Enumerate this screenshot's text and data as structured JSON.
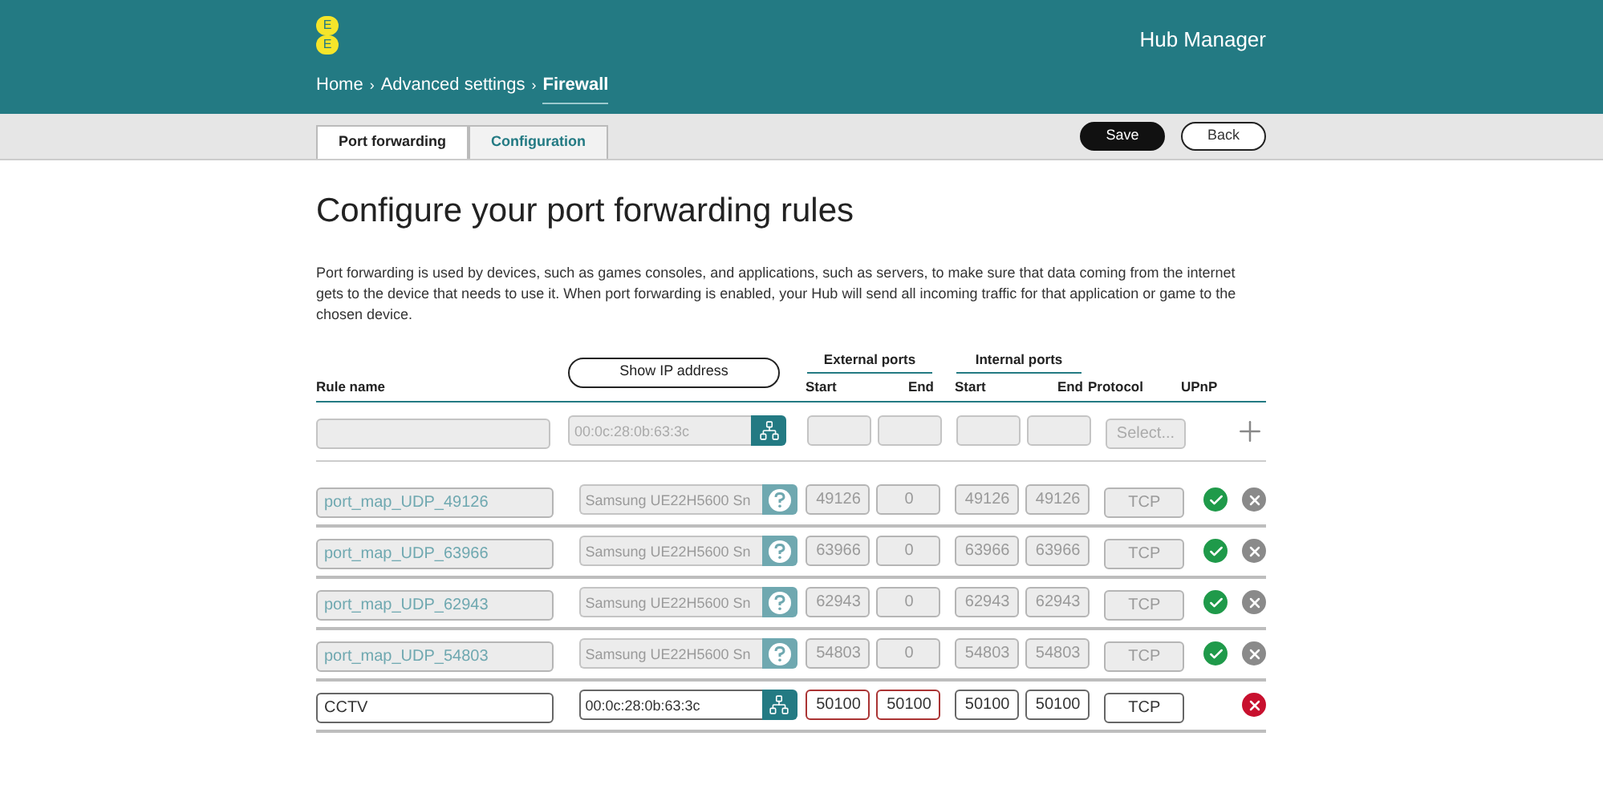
{
  "logo": {
    "letters": [
      "E",
      "E"
    ]
  },
  "header": {
    "title": "Hub Manager",
    "breadcrumb": [
      {
        "label": "Home",
        "selected": false
      },
      {
        "label": "Advanced settings",
        "selected": false
      },
      {
        "label": "Firewall",
        "selected": true
      }
    ],
    "separator": "›"
  },
  "tabs": [
    {
      "label": "Port forwarding",
      "selected": true
    },
    {
      "label": "Configuration",
      "selected": false
    }
  ],
  "actions": [
    {
      "label": "Save",
      "kind": "primary"
    },
    {
      "label": "Back",
      "kind": "secondary"
    }
  ],
  "heading": "Configure your port forwarding rules",
  "description": "Port forwarding is used by devices, such as games consoles, and applications, such as servers, to make sure that data coming from the internet gets to the device that needs to use it. When port forwarding is enabled, your Hub will send all incoming traffic for that application or game to the chosen device.",
  "table": {
    "columns": {
      "rule_name": "Rule name",
      "show_ip": "Show IP address",
      "external": "External ports",
      "internal": "Internal ports",
      "external_start": "Start",
      "external_end": "End",
      "internal_start": "Start",
      "internal_end": "End",
      "protocol": "Protocol",
      "upnp": "UPnP"
    },
    "new_rule": {
      "device_placeholder": "00:0c:28:0b:63:3c",
      "protocol_placeholder": "Select..."
    },
    "rows": [
      {
        "name": "port_map_UDP_49126",
        "device": "Samsung UE22H5600 Sn",
        "device_button": {
          "kind": "help"
        },
        "ext_start": "49126",
        "ext_end": "0",
        "int_start": "49126",
        "int_end": "49126",
        "protocol": "TCP",
        "disabled": true,
        "upnp": true,
        "invalid_external": false
      },
      {
        "name": "port_map_UDP_63966",
        "device": "Samsung UE22H5600 Sn",
        "device_button": {
          "kind": "help"
        },
        "ext_start": "63966",
        "ext_end": "0",
        "int_start": "63966",
        "int_end": "63966",
        "protocol": "TCP",
        "disabled": true,
        "upnp": true,
        "invalid_external": false
      },
      {
        "name": "port_map_UDP_62943",
        "device": "Samsung UE22H5600 Sn",
        "device_button": {
          "kind": "help"
        },
        "ext_start": "62943",
        "ext_end": "0",
        "int_start": "62943",
        "int_end": "62943",
        "protocol": "TCP",
        "disabled": true,
        "upnp": true,
        "invalid_external": false
      },
      {
        "name": "port_map_UDP_54803",
        "device": "Samsung UE22H5600 Sn",
        "device_button": {
          "kind": "help"
        },
        "ext_start": "54803",
        "ext_end": "0",
        "int_start": "54803",
        "int_end": "54803",
        "protocol": "TCP",
        "disabled": true,
        "upnp": true,
        "invalid_external": false
      },
      {
        "name": "CCTV",
        "device": "00:0c:28:0b:63:3c",
        "device_button": {
          "kind": "network"
        },
        "ext_start": "50100",
        "ext_end": "50100",
        "int_start": "50100",
        "int_end": "50100",
        "protocol": "TCP",
        "disabled": false,
        "upnp": false,
        "invalid_external": true
      }
    ]
  }
}
